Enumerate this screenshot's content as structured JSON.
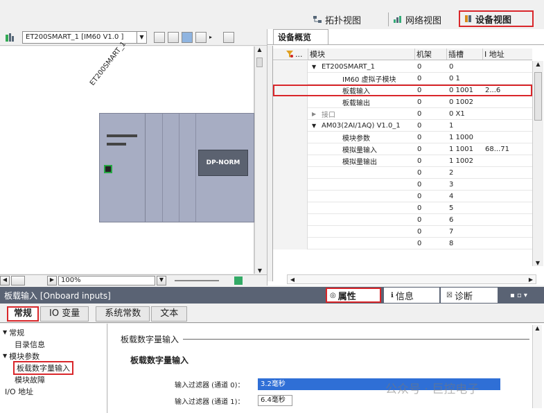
{
  "colors": {
    "highlight": "#d9262a",
    "select": "#2f6fd6",
    "device_body": "#a7adc3",
    "module_green": "#27a845"
  },
  "view_tabs": [
    {
      "label": "拓扑视图",
      "icon": "topology-icon"
    },
    {
      "label": "网络视图",
      "icon": "network-icon"
    },
    {
      "label": "设备视图",
      "icon": "device-icon"
    }
  ],
  "device_select": {
    "value": "ET200SMART_1 [IM60 V1.0 ]"
  },
  "canvas": {
    "station_label": "ET200SMART_1",
    "module_label": "DP-NORM"
  },
  "zoom": {
    "value": "100%"
  },
  "overview": {
    "title": "设备概览",
    "columns": [
      "",
      "...",
      "模块",
      "机架",
      "插槽",
      "I 地址"
    ],
    "rows": [
      {
        "arrow": "▼",
        "module": "ET200SMART_1",
        "rack": "0",
        "slot": "0",
        "iaddr": "",
        "indent": 0
      },
      {
        "arrow": "",
        "module": "IM60 虚拟子模块",
        "rack": "0",
        "slot": "0 1",
        "iaddr": "",
        "indent": 1
      },
      {
        "arrow": "",
        "module": "板载输入",
        "rack": "0",
        "slot": "0 1001",
        "iaddr": "2...6",
        "indent": 1
      },
      {
        "arrow": "",
        "module": "板载输出",
        "rack": "0",
        "slot": "0 1002",
        "iaddr": "",
        "indent": 1
      },
      {
        "arrow": "▶",
        "module": "接口",
        "rack": "0",
        "slot": "0 X1",
        "iaddr": "",
        "indent": 0,
        "grey": true
      },
      {
        "arrow": "▼",
        "module": "AM03(2AI/1AQ) V1.0_1",
        "rack": "0",
        "slot": "1",
        "iaddr": "",
        "indent": 0
      },
      {
        "arrow": "",
        "module": "模块参数",
        "rack": "0",
        "slot": "1 1000",
        "iaddr": "",
        "indent": 1
      },
      {
        "arrow": "",
        "module": "模拟量输入",
        "rack": "0",
        "slot": "1 1001",
        "iaddr": "68...71",
        "indent": 1
      },
      {
        "arrow": "",
        "module": "模拟量输出",
        "rack": "0",
        "slot": "1 1002",
        "iaddr": "",
        "indent": 1
      },
      {
        "arrow": "",
        "module": "",
        "rack": "0",
        "slot": "2",
        "iaddr": "",
        "indent": 0
      },
      {
        "arrow": "",
        "module": "",
        "rack": "0",
        "slot": "3",
        "iaddr": "",
        "indent": 0
      },
      {
        "arrow": "",
        "module": "",
        "rack": "0",
        "slot": "4",
        "iaddr": "",
        "indent": 0
      },
      {
        "arrow": "",
        "module": "",
        "rack": "0",
        "slot": "5",
        "iaddr": "",
        "indent": 0
      },
      {
        "arrow": "",
        "module": "",
        "rack": "0",
        "slot": "6",
        "iaddr": "",
        "indent": 0
      },
      {
        "arrow": "",
        "module": "",
        "rack": "0",
        "slot": "7",
        "iaddr": "",
        "indent": 0
      },
      {
        "arrow": "",
        "module": "",
        "rack": "0",
        "slot": "8",
        "iaddr": "",
        "indent": 0
      }
    ]
  },
  "inspector": {
    "title": "板载输入 [Onboard inputs]",
    "tabs": [
      {
        "label": "属性",
        "icon": "properties-icon"
      },
      {
        "label": "信息",
        "icon": "info-icon"
      },
      {
        "label": "诊断",
        "icon": "diagnostics-icon"
      }
    ],
    "subtabs": [
      "常规",
      "IO 变量",
      "系统常数",
      "文本"
    ],
    "tree": [
      {
        "label": "常规",
        "arrow": "▼",
        "indent": 0
      },
      {
        "label": "目录信息",
        "arrow": "",
        "indent": 1
      },
      {
        "label": "模块参数",
        "arrow": "▼",
        "indent": 0
      },
      {
        "label": "板载数字量输入",
        "arrow": "",
        "indent": 1,
        "selected": true
      },
      {
        "label": "模块故障",
        "arrow": "",
        "indent": 1
      },
      {
        "label": "I/O 地址",
        "arrow": "",
        "indent": 0
      }
    ],
    "section_title": "板载数字量输入",
    "subsection_title": "板载数字量输入",
    "params": [
      {
        "label": "输入过滤器 (通道 0)：",
        "value": "3.2毫秒"
      },
      {
        "label": "输入过滤器 (通道 1)：",
        "value": "6.4毫秒"
      }
    ]
  },
  "watermark": "公众号 · 巨控电子"
}
